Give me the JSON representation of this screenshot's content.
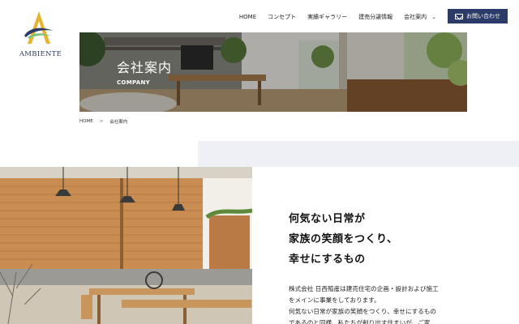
{
  "brand": {
    "logo_text": "AMBIENTE"
  },
  "nav": {
    "items": [
      "HOME",
      "コンセプト",
      "実績ギャラリー",
      "建売分譲情報",
      "会社案内"
    ],
    "contact_label": "お問い合わせ",
    "accent_color": "#2b3a67"
  },
  "hero": {
    "title": "会社案内",
    "subtitle": "COMPANY"
  },
  "breadcrumb": {
    "home": "HOME",
    "separator": ">",
    "current": "会社案内"
  },
  "headline": [
    "何気ない日常が",
    "家族の笑顔をつくり、",
    "幸せにするもの"
  ],
  "body": [
    "株式会社 日西殖産は建売住宅の企画・設計および施工",
    "をメインに事業をしております。",
    "何気ない日常が家族の笑顔をつくり、幸せにするもの",
    "であるのと同様、私たちが創り出す住まいが、ご家"
  ]
}
